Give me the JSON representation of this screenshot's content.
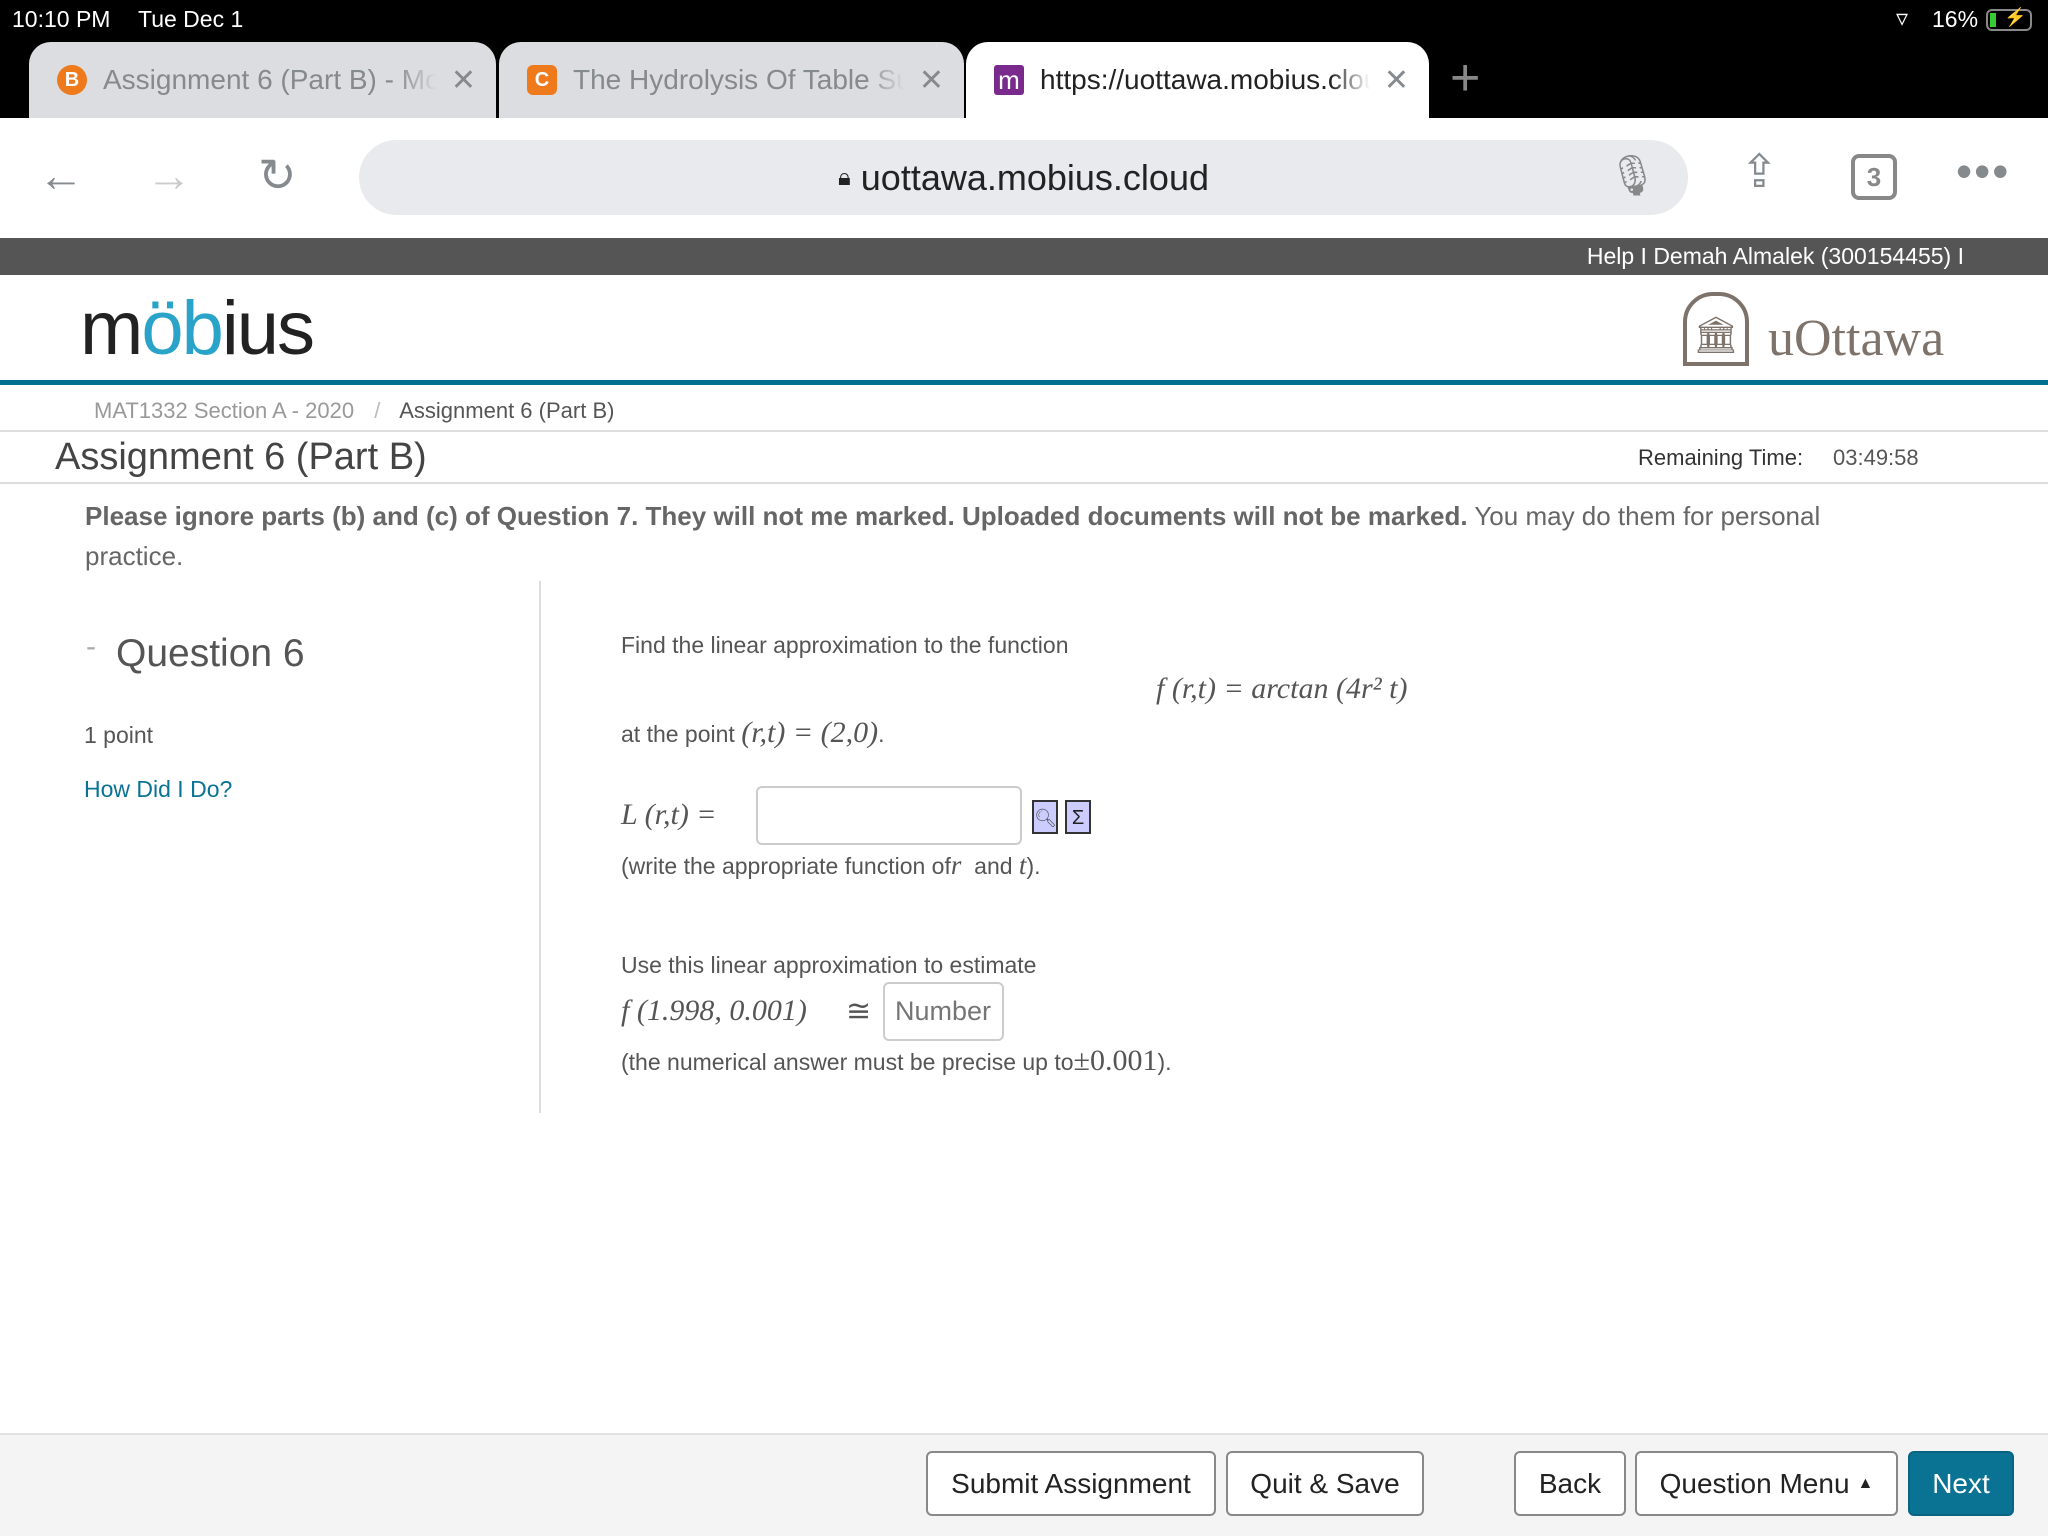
{
  "status": {
    "time": "10:10 PM",
    "date": "Tue Dec 1",
    "battery": "16%",
    "icons": [
      "wifi-icon",
      "battery-charging-icon"
    ]
  },
  "tabs": [
    {
      "title": "Assignment 6 (Part B) - Mobius",
      "favicon": "B",
      "favicon_color": "#ee7a1c"
    },
    {
      "title": "The Hydrolysis Of Table Sugar",
      "favicon": "C",
      "favicon_color": "#ee7a1c"
    },
    {
      "title": "https://uottawa.mobius.cloud",
      "favicon": "m",
      "favicon_color": "#7a2a8c",
      "active": true
    }
  ],
  "toolbar": {
    "url": "uottawa.mobius.cloud",
    "tab_count": "3"
  },
  "userbar": {
    "help": "Help",
    "user": "Demah Almalek (300154455)",
    "sep": "I"
  },
  "header": {
    "logo": "möbius",
    "university": "uOttawa",
    "accent": "#00708f"
  },
  "breadcrumb": {
    "course": "MAT1332 Section A - 2020",
    "sep": "/",
    "current": "Assignment 6 (Part B)"
  },
  "page": {
    "title": "Assignment 6 (Part B)",
    "remaining_label": "Remaining Time:",
    "remaining_value": "03:49:58"
  },
  "notice": {
    "bold": "Please ignore parts (b) and (c) of Question 7.  They will not me marked.  Uploaded documents will not be marked.",
    "normal": " You may do them for personal practice."
  },
  "question": {
    "title": "Question 6",
    "collapse": "-",
    "points": "1 point",
    "how_link": "How Did I Do?"
  },
  "body": {
    "intro": "Find the linear approximation to the function",
    "function": "f (r,t) = arctan (4r² t)",
    "at_point_prefix": "at the point ",
    "at_point_math": "(r,t) = (2,0)",
    "at_point_suffix": " .",
    "L_label": "L (r,t) =",
    "L_value": "",
    "write_prefix": "(write the appropriate function of ",
    "write_r": "r",
    "write_and": "  and ",
    "write_t": "t",
    "write_suffix": " ).",
    "estimate_intro": "Use this linear approximation to estimate",
    "estimate_label": "f (1.998, 0.001)",
    "approx": "≅",
    "number_placeholder": "Number",
    "precision_prefix": "(the numerical answer must be precise up to ",
    "precision_math": "±0.001",
    "precision_suffix": " )."
  },
  "footer": {
    "submit": "Submit Assignment",
    "quit": "Quit & Save",
    "back": "Back",
    "menu": "Question Menu",
    "next": "Next",
    "next_color": "#0a7394"
  }
}
